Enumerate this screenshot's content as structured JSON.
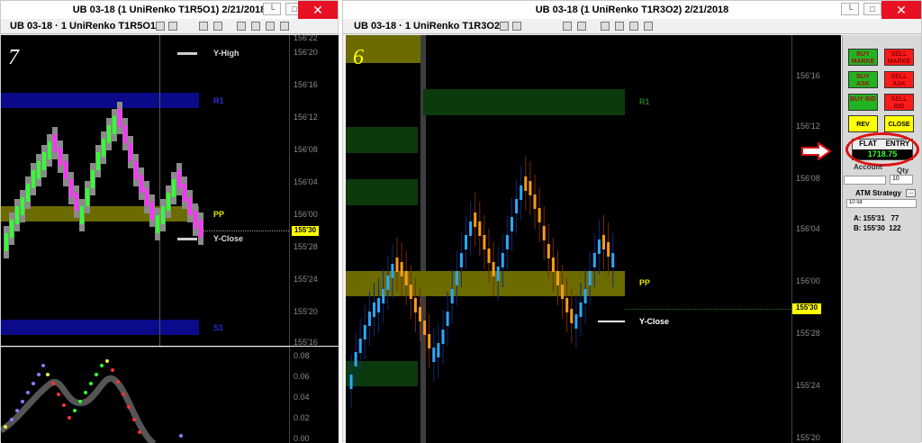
{
  "left_window": {
    "title": "UB 03-18 (1 UniRenko T1R5O1)  2/21/2018",
    "toolbar_label": "UB 03-18 · 1 UniRenko T1R5O1 ·",
    "chart_number": "7",
    "price_ticks": [
      "156'22",
      "156'20",
      "156'16",
      "156'12",
      "156'08",
      "156'04",
      "156'00",
      "155'28",
      "155'24",
      "155'20",
      "155'16"
    ],
    "current_price": "155'30",
    "labels": {
      "y_high": "Y-High",
      "r1": "R1",
      "pp": "PP",
      "y_close": "Y-Close",
      "s1": "S1"
    },
    "indicator_ticks": [
      "0.08",
      "0.06",
      "0.04",
      "0.02",
      "0.00"
    ]
  },
  "right_window": {
    "title": "UB 03-18 (1 UniRenko T1R3O2)  2/21/2018",
    "toolbar_label": "UB 03-18 · 1 UniRenko T1R3O2 ·",
    "chart_number": "6",
    "price_ticks": [
      "156'16",
      "156'12",
      "156'08",
      "156'04",
      "156'00",
      "155'28",
      "155'24",
      "155'20"
    ],
    "current_price": "155'30",
    "labels": {
      "r1": "R1",
      "pp": "PP",
      "y_close": "Y-Close"
    }
  },
  "chart_trader": {
    "buy_market": "BUY MARKE",
    "sell_market": "SELL MARKE",
    "buy_ask": "BUY ASK",
    "sell_ask": "SELL ASK",
    "buy_bid": "BUY BID",
    "sell_bid": "SELL BID",
    "rev": "REV",
    "close": "CLOSE",
    "flat": "FLAT",
    "entry": "ENTRY",
    "pnl": "1718.75",
    "account_label": "Account",
    "qty_label": "Qty",
    "qty_value": "10",
    "atm_label": "ATM Strategy",
    "atm_value": "10 lot",
    "level_a": "A: 155'31   77",
    "level_b": "B: 155'30  122"
  },
  "colors": {
    "green_brick": "#33ff33",
    "magenta_brick": "#ff33ff",
    "blue_bar": "#2aa8ff",
    "orange_bar": "#ff9a1a",
    "pp_zone": "#6b6b00",
    "r1_zone": "#0c3a0c",
    "blue_zone": "#0a0a8a",
    "price_tag": "#ffff00"
  },
  "icons": [
    "restore-icon",
    "maximize-icon",
    "close-icon",
    "arrow-right-icon"
  ]
}
